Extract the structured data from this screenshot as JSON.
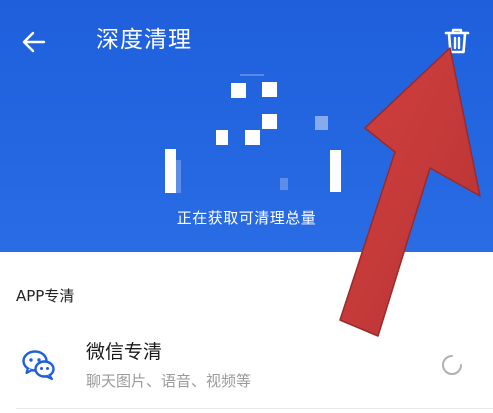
{
  "header": {
    "title": "深度清理",
    "status": "正在获取可清理总量",
    "background_color": "#2466e0"
  },
  "icons": {
    "back": "arrow-left-icon",
    "trash": "trash-icon",
    "wechat": "wechat-icon",
    "loading": "loading-spinner-icon"
  },
  "section": {
    "title": "APP专清"
  },
  "items": [
    {
      "title": "微信专清",
      "subtitle": "聊天图片、语音、视频等"
    }
  ],
  "colors": {
    "accent": "#2466e0",
    "icon_blue": "#1f5fdc",
    "arrow_red": "#c8393a"
  }
}
